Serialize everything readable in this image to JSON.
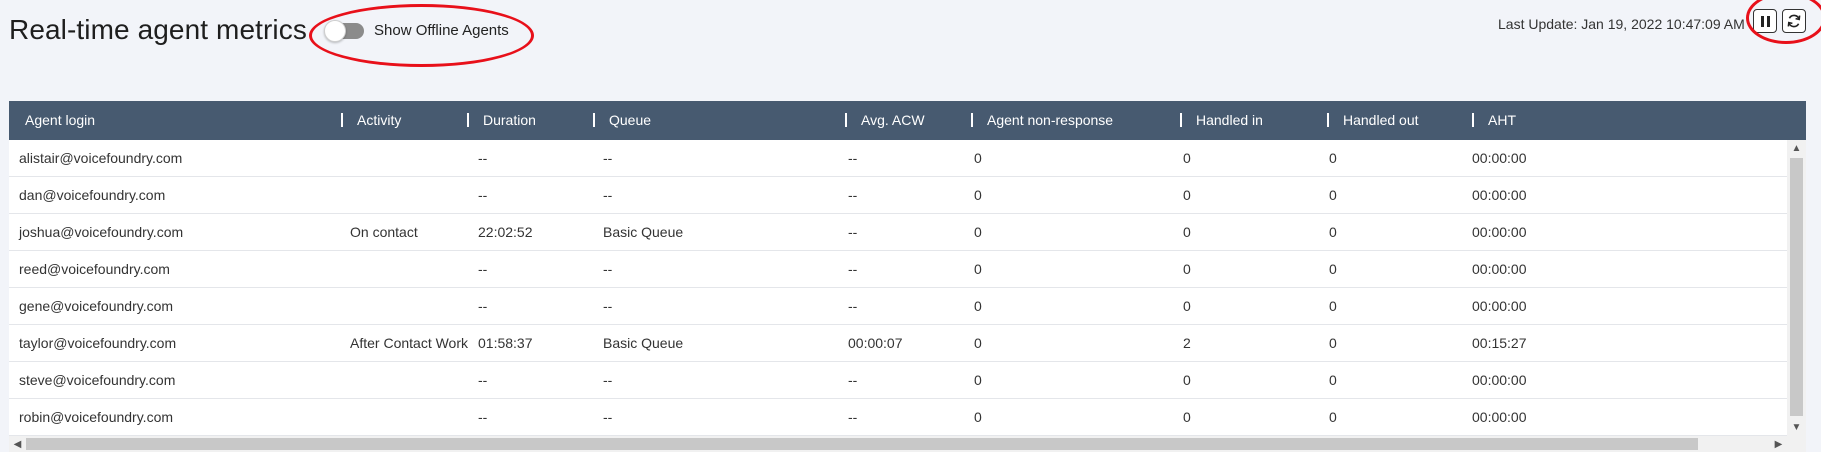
{
  "header": {
    "title": "Real-time agent metrics",
    "toggle_label": "Show Offline Agents",
    "toggle_on": false,
    "last_update": "Last Update: Jan 19, 2022 10:47:09 AM",
    "pause_icon": "pause-icon",
    "refresh_icon": "refresh-icon"
  },
  "annotation_color": "#e8101a",
  "table": {
    "header_color": "#475a70",
    "columns": [
      "Agent login",
      "Activity",
      "Duration",
      "Queue",
      "Avg. ACW",
      "Agent non-response",
      "Handled in",
      "Handled out",
      "AHT"
    ],
    "rows": [
      [
        "alistair@voicefoundry.com",
        "",
        "--",
        "--",
        "--",
        "0",
        "0",
        "0",
        "00:00:00"
      ],
      [
        "dan@voicefoundry.com",
        "",
        "--",
        "--",
        "--",
        "0",
        "0",
        "0",
        "00:00:00"
      ],
      [
        "joshua@voicefoundry.com",
        "On contact",
        "22:02:52",
        "Basic Queue",
        "--",
        "0",
        "0",
        "0",
        "00:00:00"
      ],
      [
        "reed@voicefoundry.com",
        "",
        "--",
        "--",
        "--",
        "0",
        "0",
        "0",
        "00:00:00"
      ],
      [
        "gene@voicefoundry.com",
        "",
        "--",
        "--",
        "--",
        "0",
        "0",
        "0",
        "00:00:00"
      ],
      [
        "taylor@voicefoundry.com",
        "After Contact Work",
        "01:58:37",
        "Basic Queue",
        "00:00:07",
        "0",
        "2",
        "0",
        "00:15:27"
      ],
      [
        "steve@voicefoundry.com",
        "",
        "--",
        "--",
        "--",
        "0",
        "0",
        "0",
        "00:00:00"
      ],
      [
        "robin@voicefoundry.com",
        "",
        "--",
        "--",
        "--",
        "0",
        "0",
        "0",
        "00:00:00"
      ]
    ]
  }
}
